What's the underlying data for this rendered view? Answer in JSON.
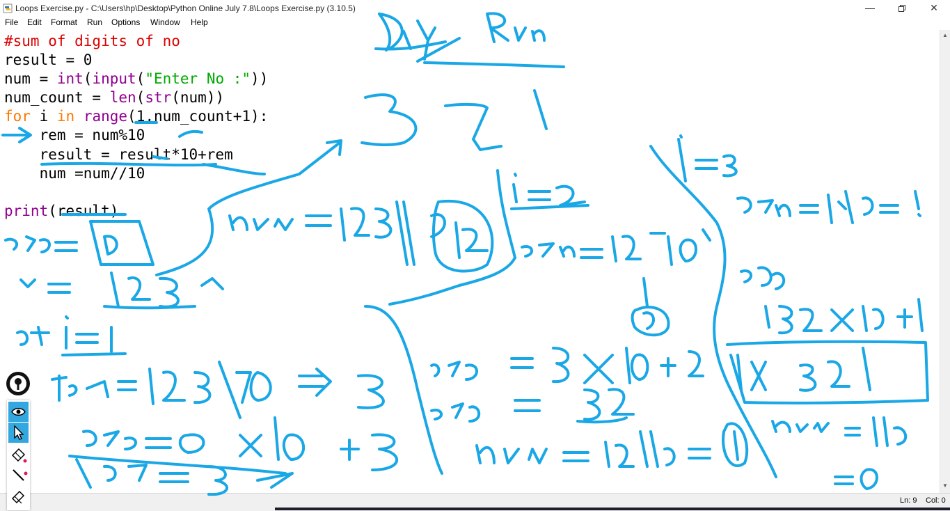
{
  "window": {
    "title": "Loops Exercise.py - C:\\Users\\hp\\Desktop\\Python Online July 7.8\\Loops Exercise.py (3.10.5)",
    "icon": "python-file-icon",
    "controls": [
      "minimize-icon",
      "restore-icon",
      "close-icon"
    ]
  },
  "menu": {
    "file": "File",
    "edit": "Edit",
    "format": "Format",
    "run": "Run",
    "options": "Options",
    "window": "Window",
    "help": "Help"
  },
  "code": {
    "l1": "#sum of digits of no",
    "l2": "result = 0",
    "l3_a": "num = ",
    "l3_b": "int",
    "l3_c": "(",
    "l3_d": "input",
    "l3_e": "(",
    "l3_f": "\"Enter No :\"",
    "l3_g": "))",
    "l4_a": "num_count = ",
    "l4_b": "len",
    "l4_c": "(",
    "l4_d": "str",
    "l4_e": "(num))",
    "l5_a": "for",
    "l5_b": " i ",
    "l5_c": "in",
    "l5_d": " ",
    "l5_e": "range",
    "l5_f": "(1,num_count+1):",
    "l6": "    rem = num%10",
    "l7": "    result = result*10+rem",
    "l8": "    num =num//10",
    "l9": "",
    "l10_a": "print",
    "l10_b": "(result)"
  },
  "status": {
    "line": "Ln: 9",
    "col": "Col: 0"
  },
  "annotations": {
    "tools": [
      "eye-icon",
      "pointer-icon",
      "eraser-icon",
      "pen-icon",
      "highlighter-icon"
    ],
    "ink_color": "#1aa7e6"
  },
  "colors": {
    "comment": "#dd0000",
    "keyword": "#ff7700",
    "builtin": "#900090",
    "string": "#00aa00"
  }
}
